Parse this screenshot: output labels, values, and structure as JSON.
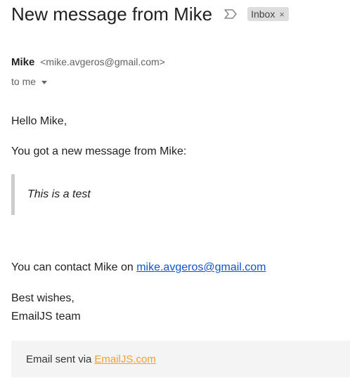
{
  "email": {
    "subject": "New message from Mike",
    "label": "Inbox",
    "label_remove": "×",
    "sender_name": "Mike",
    "sender_email": "<mike.avgeros@gmail.com>",
    "recipient": "to me"
  },
  "message": {
    "greeting": "Hello Mike,",
    "intro": "You got a new message from Mike:",
    "quote": "This is a test",
    "contact_prefix": "You can contact Mike on",
    "contact_email": "mike.avgeros@gmail.com",
    "signoff_line1": "Best wishes,",
    "signoff_line2": "EmailJS team"
  },
  "footer": {
    "prefix": "Email sent via",
    "link_text": "EmailJS.com"
  },
  "colors": {
    "link": "#1155cc",
    "footer_link": "#f0a030",
    "footer_bg": "#f4f4f4",
    "quote_border": "#cccccc"
  },
  "icons": {
    "important_marker": "importance-marker-icon",
    "dropdown": "chevron-down-icon",
    "remove_label": "close-icon"
  }
}
